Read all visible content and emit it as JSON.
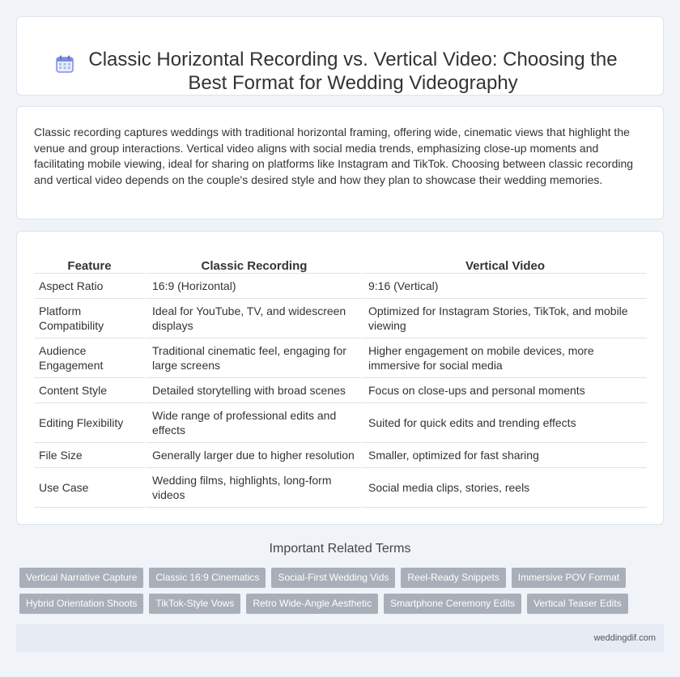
{
  "header": {
    "title": "Classic Horizontal Recording vs. Vertical Video: Choosing the Best Format for Wedding Videography",
    "icon": "calendar-icon"
  },
  "intro": {
    "text": "Classic recording captures weddings with traditional horizontal framing, offering wide, cinematic views that highlight the venue and group interactions. Vertical video aligns with social media trends, emphasizing close-up moments and facilitating mobile viewing, ideal for sharing on platforms like Instagram and TikTok. Choosing between classic recording and vertical video depends on the couple's desired style and how they plan to showcase their wedding memories."
  },
  "table": {
    "headers": [
      "Feature",
      "Classic Recording",
      "Vertical Video"
    ],
    "rows": [
      [
        "Aspect Ratio",
        "16:9 (Horizontal)",
        "9:16 (Vertical)"
      ],
      [
        "Platform Compatibility",
        "Ideal for YouTube, TV, and widescreen displays",
        "Optimized for Instagram Stories, TikTok, and mobile viewing"
      ],
      [
        "Audience Engagement",
        "Traditional cinematic feel, engaging for large screens",
        "Higher engagement on mobile devices, more immersive for social media"
      ],
      [
        "Content Style",
        "Detailed storytelling with broad scenes",
        "Focus on close-ups and personal moments"
      ],
      [
        "Editing Flexibility",
        "Wide range of professional edits and effects",
        "Suited for quick edits and trending effects"
      ],
      [
        "File Size",
        "Generally larger due to higher resolution",
        "Smaller, optimized for fast sharing"
      ],
      [
        "Use Case",
        "Wedding films, highlights, long-form videos",
        "Social media clips, stories, reels"
      ]
    ]
  },
  "related": {
    "title": "Important Related Terms",
    "tags": [
      "Vertical Narrative Capture",
      "Classic 16:9 Cinematics",
      "Social-First Wedding Vids",
      "Reel-Ready Snippets",
      "Immersive POV Format",
      "Hybrid Orientation Shoots",
      "TikTok-Style Vows",
      "Retro Wide-Angle Aesthetic",
      "Smartphone Ceremony Edits",
      "Vertical Teaser Edits"
    ]
  },
  "footer": {
    "text": "weddingdif.com"
  },
  "colors": {
    "background": "#f0f3f8",
    "tag_bg": "#a9afb9",
    "footer_bg": "#e6ebf4",
    "icon_accent": "#7b8fe0"
  }
}
